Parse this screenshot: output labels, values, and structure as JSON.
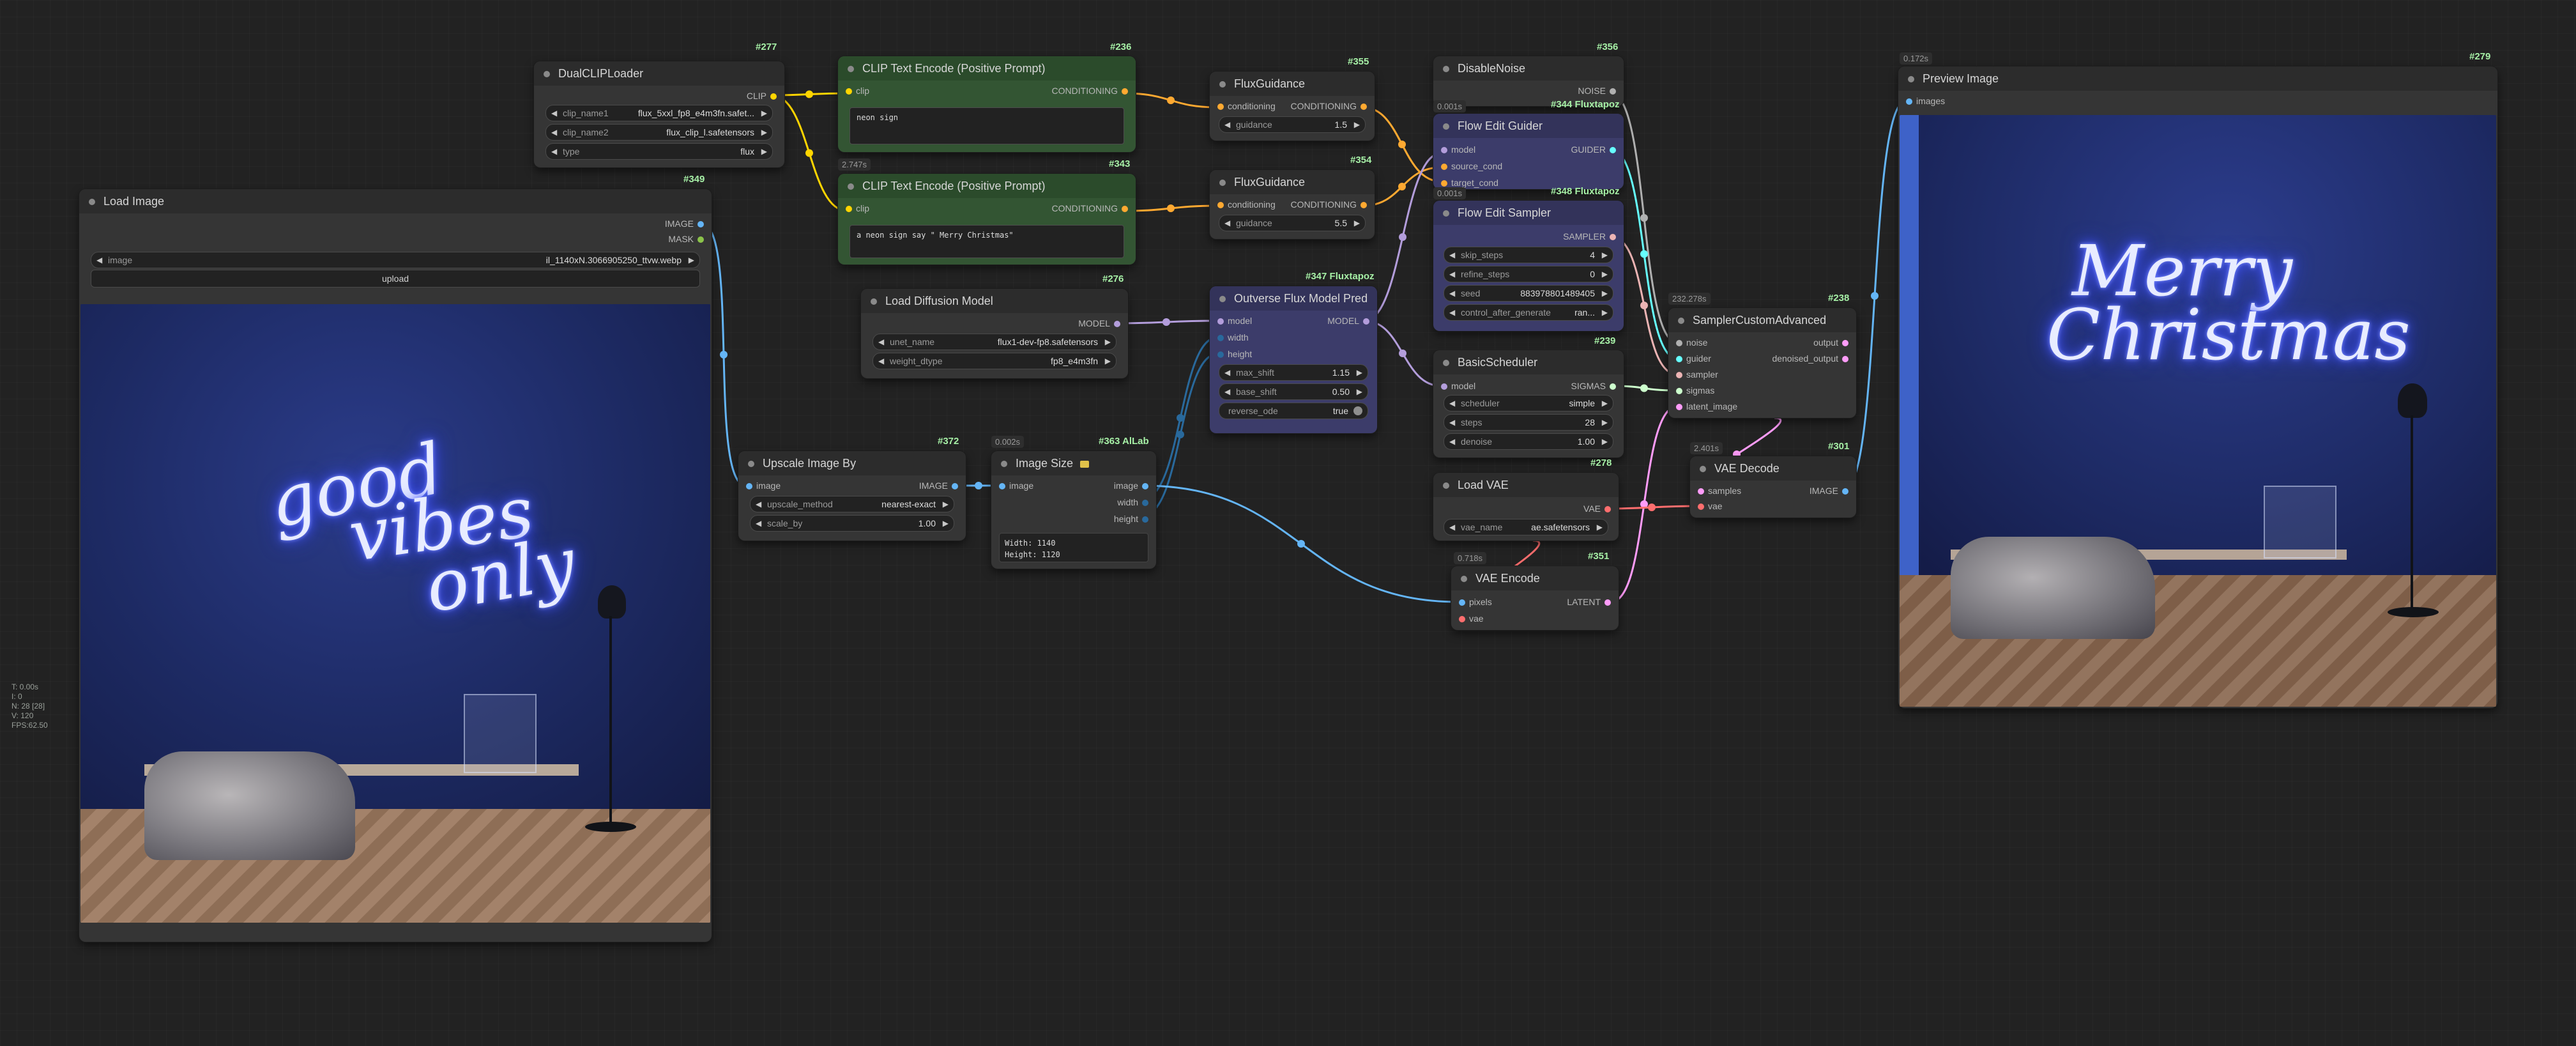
{
  "nodes": {
    "dual_clip": {
      "title": "DualCLIPLoader",
      "id": "#277",
      "output": "CLIP",
      "widgets": [
        {
          "label": "clip_name1",
          "value": "flux_5xxl_fp8_e4m3fn.safet..."
        },
        {
          "label": "clip_name2",
          "value": "flux_clip_l.safetensors"
        },
        {
          "label": "type",
          "value": "flux"
        }
      ]
    },
    "clip_pos_1": {
      "title": "CLIP Text Encode (Positive Prompt)",
      "id": "#236",
      "input": "clip",
      "output": "CONDITIONING",
      "text": "neon sign"
    },
    "clip_pos_2": {
      "title": "CLIP Text Encode (Positive Prompt)",
      "id": "#343",
      "timing": "2.747s",
      "input": "clip",
      "output": "CONDITIONING",
      "text": "a neon sign say \" Merry Christmas\""
    },
    "flux_guidance_1": {
      "title": "FluxGuidance",
      "id": "#355",
      "input": "conditioning",
      "output": "CONDITIONING",
      "widget": {
        "label": "guidance",
        "value": "1.5"
      }
    },
    "flux_guidance_2": {
      "title": "FluxGuidance",
      "id": "#354",
      "input": "conditioning",
      "output": "CONDITIONING",
      "widget": {
        "label": "guidance",
        "value": "5.5"
      }
    },
    "disable_noise": {
      "title": "DisableNoise",
      "id": "#356",
      "output": "NOISE"
    },
    "flow_edit_guider": {
      "title": "Flow Edit Guider",
      "id": "#344 Fluxtapoz",
      "timing": "0.001s",
      "inputs": [
        "model",
        "source_cond",
        "target_cond"
      ],
      "output": "GUIDER"
    },
    "flow_edit_sampler": {
      "title": "Flow Edit Sampler",
      "id": "#348 Fluxtapoz",
      "timing": "0.001s",
      "output": "SAMPLER",
      "widgets": [
        {
          "label": "skip_steps",
          "value": "4"
        },
        {
          "label": "refine_steps",
          "value": "0"
        },
        {
          "label": "seed",
          "value": "883978801489405"
        },
        {
          "label": "control_after_generate",
          "value": "ran..."
        }
      ]
    },
    "load_image": {
      "title": "Load Image",
      "id": "#349",
      "outputs": [
        "IMAGE",
        "MASK"
      ],
      "widget": {
        "label": "image",
        "value": "il_1140xN.3066905250_ttvw.webp"
      },
      "upload_label": "upload",
      "neon_lines": [
        "good",
        "vibes",
        "only"
      ]
    },
    "load_diffusion": {
      "title": "Load Diffusion Model",
      "id": "#276",
      "output": "MODEL",
      "widgets": [
        {
          "label": "unet_name",
          "value": "flux1-dev-fp8.safetensors"
        },
        {
          "label": "weight_dtype",
          "value": "fp8_e4m3fn"
        }
      ]
    },
    "outverse": {
      "title": "Outverse Flux Model Pred",
      "id": "#347 Fluxtapoz",
      "inputs": [
        "model",
        "width",
        "height"
      ],
      "output": "MODEL",
      "widgets": [
        {
          "label": "max_shift",
          "value": "1.15"
        },
        {
          "label": "base_shift",
          "value": "0.50"
        },
        {
          "label": "reverse_ode",
          "value": "true"
        }
      ]
    },
    "basic_scheduler": {
      "title": "BasicScheduler",
      "id": "#239",
      "input": "model",
      "output": "SIGMAS",
      "widgets": [
        {
          "label": "scheduler",
          "value": "simple"
        },
        {
          "label": "steps",
          "value": "28"
        },
        {
          "label": "denoise",
          "value": "1.00"
        }
      ]
    },
    "sampler_custom": {
      "title": "SamplerCustomAdvanced",
      "id": "#238",
      "timing": "232.278s",
      "inputs": [
        "noise",
        "guider",
        "sampler",
        "sigmas",
        "latent_image"
      ],
      "outputs": [
        "output",
        "denoised_output"
      ]
    },
    "upscale": {
      "title": "Upscale Image By",
      "id": "#372",
      "input": "image",
      "output": "IMAGE",
      "widgets": [
        {
          "label": "upscale_method",
          "value": "nearest-exact"
        },
        {
          "label": "scale_by",
          "value": "1.00"
        }
      ]
    },
    "image_size": {
      "title": "Image Size",
      "id": "#363 AlLab",
      "timing": "0.002s",
      "input": "image",
      "outputs": [
        "image",
        "width",
        "height"
      ],
      "readout": [
        "Width: 1140",
        "Height: 1120"
      ]
    },
    "load_vae": {
      "title": "Load VAE",
      "id": "#278",
      "output": "VAE",
      "widget": {
        "label": "vae_name",
        "value": "ae.safetensors"
      }
    },
    "vae_encode": {
      "title": "VAE Encode",
      "id": "#351",
      "timing": "0.718s",
      "inputs": [
        "pixels",
        "vae"
      ],
      "output": "LATENT"
    },
    "vae_decode": {
      "title": "VAE Decode",
      "id": "#301",
      "timing": "2.401s",
      "inputs": [
        "samples",
        "vae"
      ],
      "output": "IMAGE"
    },
    "preview": {
      "title": "Preview Image",
      "id": "#279",
      "timing": "0.172s",
      "input": "images",
      "neon_lines": [
        "Merry",
        "Christmas"
      ]
    }
  },
  "stats": [
    "T: 0.00s",
    "I: 0",
    "N: 28 [28]",
    "V: 120",
    "FPS:62.50"
  ],
  "colors": {
    "clip": "#ffd500",
    "conditioning": "#ffa931",
    "model": "#b39ddb",
    "image": "#64b5f6",
    "latent": "#ff9cf9",
    "vae": "#ff6e6e",
    "noise": "#b0b0b0",
    "guider": "#66ffff",
    "sampler": "#ecb4b4",
    "sigmas": "#cdffcd",
    "int": "#29699c"
  }
}
